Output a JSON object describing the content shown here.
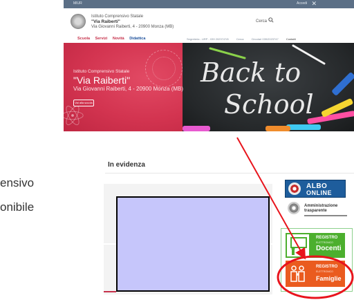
{
  "topbar": {
    "left_label": "MIUR",
    "right_label": "Accedi",
    "close_glyph": "✕"
  },
  "header": {
    "line1": "Istituto Comprensivo Statale",
    "line2": "\"Via Raiberti\"",
    "line3": "Via Giovanni Raiberti, 4 - 20900 Monza (MB)",
    "search_label": "Cerca",
    "search_icon": "search-icon"
  },
  "nav": {
    "items": [
      "Scuola",
      "Servizi",
      "Novità",
      "Didattica"
    ]
  },
  "utility": {
    "items": [
      "Segreteria - URP - 039 2023747/8",
      "Cerca",
      "Contatti",
      "Circolari 039/2023747"
    ]
  },
  "hero": {
    "line1": "Istituto Comprensivo Statale",
    "line2": "\"Via Raiberti\"",
    "line3": "Via Giovanni Raiberti, 4 - 20900 Monza (MB)",
    "button": "Vai alla scuola",
    "image_text_1": "Back to",
    "image_text_2": "School"
  },
  "evidenza": {
    "title": "In evidenza"
  },
  "left_cut": {
    "line1": "ensivo",
    "line2": "onibile"
  },
  "sidebar": {
    "albo_1": "ALBO",
    "albo_2": "ONLINE",
    "amm_1": "Amministrazione",
    "amm_2": "trasparente",
    "docenti_1": "REGISTRO",
    "docenti_2": "ELETTRONICO",
    "docenti_3": "Docenti",
    "famiglie_1": "REGISTRO",
    "famiglie_2": "ELETTRONICO",
    "famiglie_3": "Famiglie"
  },
  "colors": {
    "accent_red": "#c6304a",
    "annotation_red": "#e8141c",
    "green": "#4caf2e",
    "orange": "#ea5b1f",
    "blue": "#1e5d9c"
  }
}
